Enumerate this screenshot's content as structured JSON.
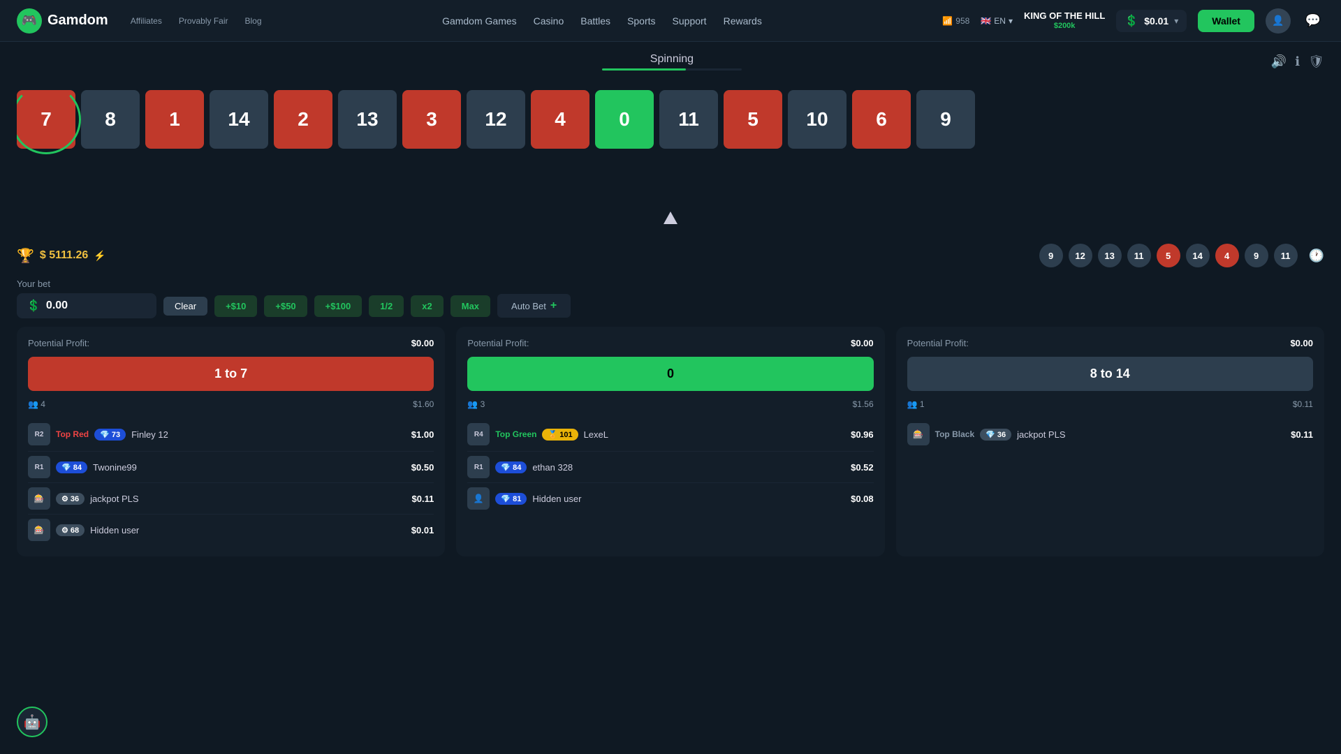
{
  "header": {
    "logo_text": "Gamdom",
    "nav_secondary": [
      "Affiliates",
      "Provably Fair",
      "Blog"
    ],
    "nav_main": [
      "Gamdom Games",
      "Casino",
      "Battles",
      "Sports",
      "Support",
      "Rewards"
    ],
    "promo": {
      "title": "KING OF THE HILL",
      "amount": "$200k"
    },
    "balance": "$0.01",
    "wallet_label": "Wallet",
    "live_count": "958",
    "lang": "EN"
  },
  "roulette": {
    "status": "Spinning",
    "cells": [
      {
        "value": "7",
        "type": "red",
        "selected": true
      },
      {
        "value": "8",
        "type": "gray"
      },
      {
        "value": "1",
        "type": "red"
      },
      {
        "value": "14",
        "type": "gray"
      },
      {
        "value": "2",
        "type": "red"
      },
      {
        "value": "13",
        "type": "gray"
      },
      {
        "value": "3",
        "type": "red"
      },
      {
        "value": "12",
        "type": "gray"
      },
      {
        "value": "4",
        "type": "red"
      },
      {
        "value": "0",
        "type": "green"
      },
      {
        "value": "11",
        "type": "gray"
      },
      {
        "value": "5",
        "type": "red"
      },
      {
        "value": "10",
        "type": "gray"
      },
      {
        "value": "6",
        "type": "red"
      },
      {
        "value": "9",
        "type": "gray"
      }
    ]
  },
  "jackpot": {
    "amount": "$ 5111.26",
    "icon": "🏆"
  },
  "last_results": [
    {
      "value": "9",
      "type": "gray"
    },
    {
      "value": "12",
      "type": "gray"
    },
    {
      "value": "13",
      "type": "gray"
    },
    {
      "value": "11",
      "type": "gray"
    },
    {
      "value": "5",
      "type": "red"
    },
    {
      "value": "14",
      "type": "gray"
    },
    {
      "value": "4",
      "type": "red"
    },
    {
      "value": "9",
      "type": "gray"
    },
    {
      "value": "11",
      "type": "gray"
    }
  ],
  "bet": {
    "label": "Your bet",
    "value": "0.00",
    "currency_icon": "💲",
    "clear_label": "Clear",
    "actions": [
      "+$10",
      "+$50",
      "+$100",
      "1/2",
      "x2",
      "Max"
    ],
    "auto_bet_label": "Auto Bet"
  },
  "panels": [
    {
      "id": "red",
      "potential_profit_label": "Potential Profit:",
      "potential_profit_value": "$0.00",
      "bet_label": "1 to 7",
      "type": "red",
      "user_count": "4",
      "total_bet": "$1.60",
      "top_section": {
        "label": "Top Red",
        "players": [
          {
            "rank": "R2",
            "badge_value": "73",
            "badge_type": "blue",
            "name": "Finley 12",
            "bet": "$1.00"
          }
        ]
      },
      "players": [
        {
          "rank": "R1",
          "badge_value": "84",
          "badge_type": "blue",
          "name": "Twonine99",
          "bet": "$0.50"
        },
        {
          "rank": "",
          "badge_value": "36",
          "badge_type": "gray",
          "name": "jackpot PLS",
          "bet": "$0.11"
        },
        {
          "rank": "",
          "badge_value": "68",
          "badge_type": "gray",
          "name": "Hidden user",
          "bet": "$0.01"
        }
      ]
    },
    {
      "id": "green",
      "potential_profit_label": "Potential Profit:",
      "potential_profit_value": "$0.00",
      "bet_label": "0",
      "type": "green",
      "user_count": "3",
      "total_bet": "$1.56",
      "top_section": {
        "label": "Top Green",
        "players": [
          {
            "rank": "R4",
            "badge_value": "101",
            "badge_type": "yellow",
            "name": "LexeL",
            "bet": "$0.96"
          }
        ]
      },
      "players": [
        {
          "rank": "R1",
          "badge_value": "84",
          "badge_type": "blue",
          "name": "ethan 328",
          "bet": "$0.52"
        },
        {
          "rank": "",
          "badge_value": "81",
          "badge_type": "blue",
          "name": "Hidden user",
          "bet": "$0.08"
        }
      ]
    },
    {
      "id": "black",
      "potential_profit_label": "Potential Profit:",
      "potential_profit_value": "$0.00",
      "bet_label": "8 to 14",
      "type": "dark",
      "user_count": "1",
      "total_bet": "$0.11",
      "top_section": {
        "label": "Top Black",
        "players": [
          {
            "rank": "",
            "badge_value": "36",
            "badge_type": "gray",
            "name": "jackpot PLS",
            "bet": "$0.11"
          }
        ]
      },
      "players": []
    }
  ],
  "chatbot": {
    "icon": "🤖"
  }
}
